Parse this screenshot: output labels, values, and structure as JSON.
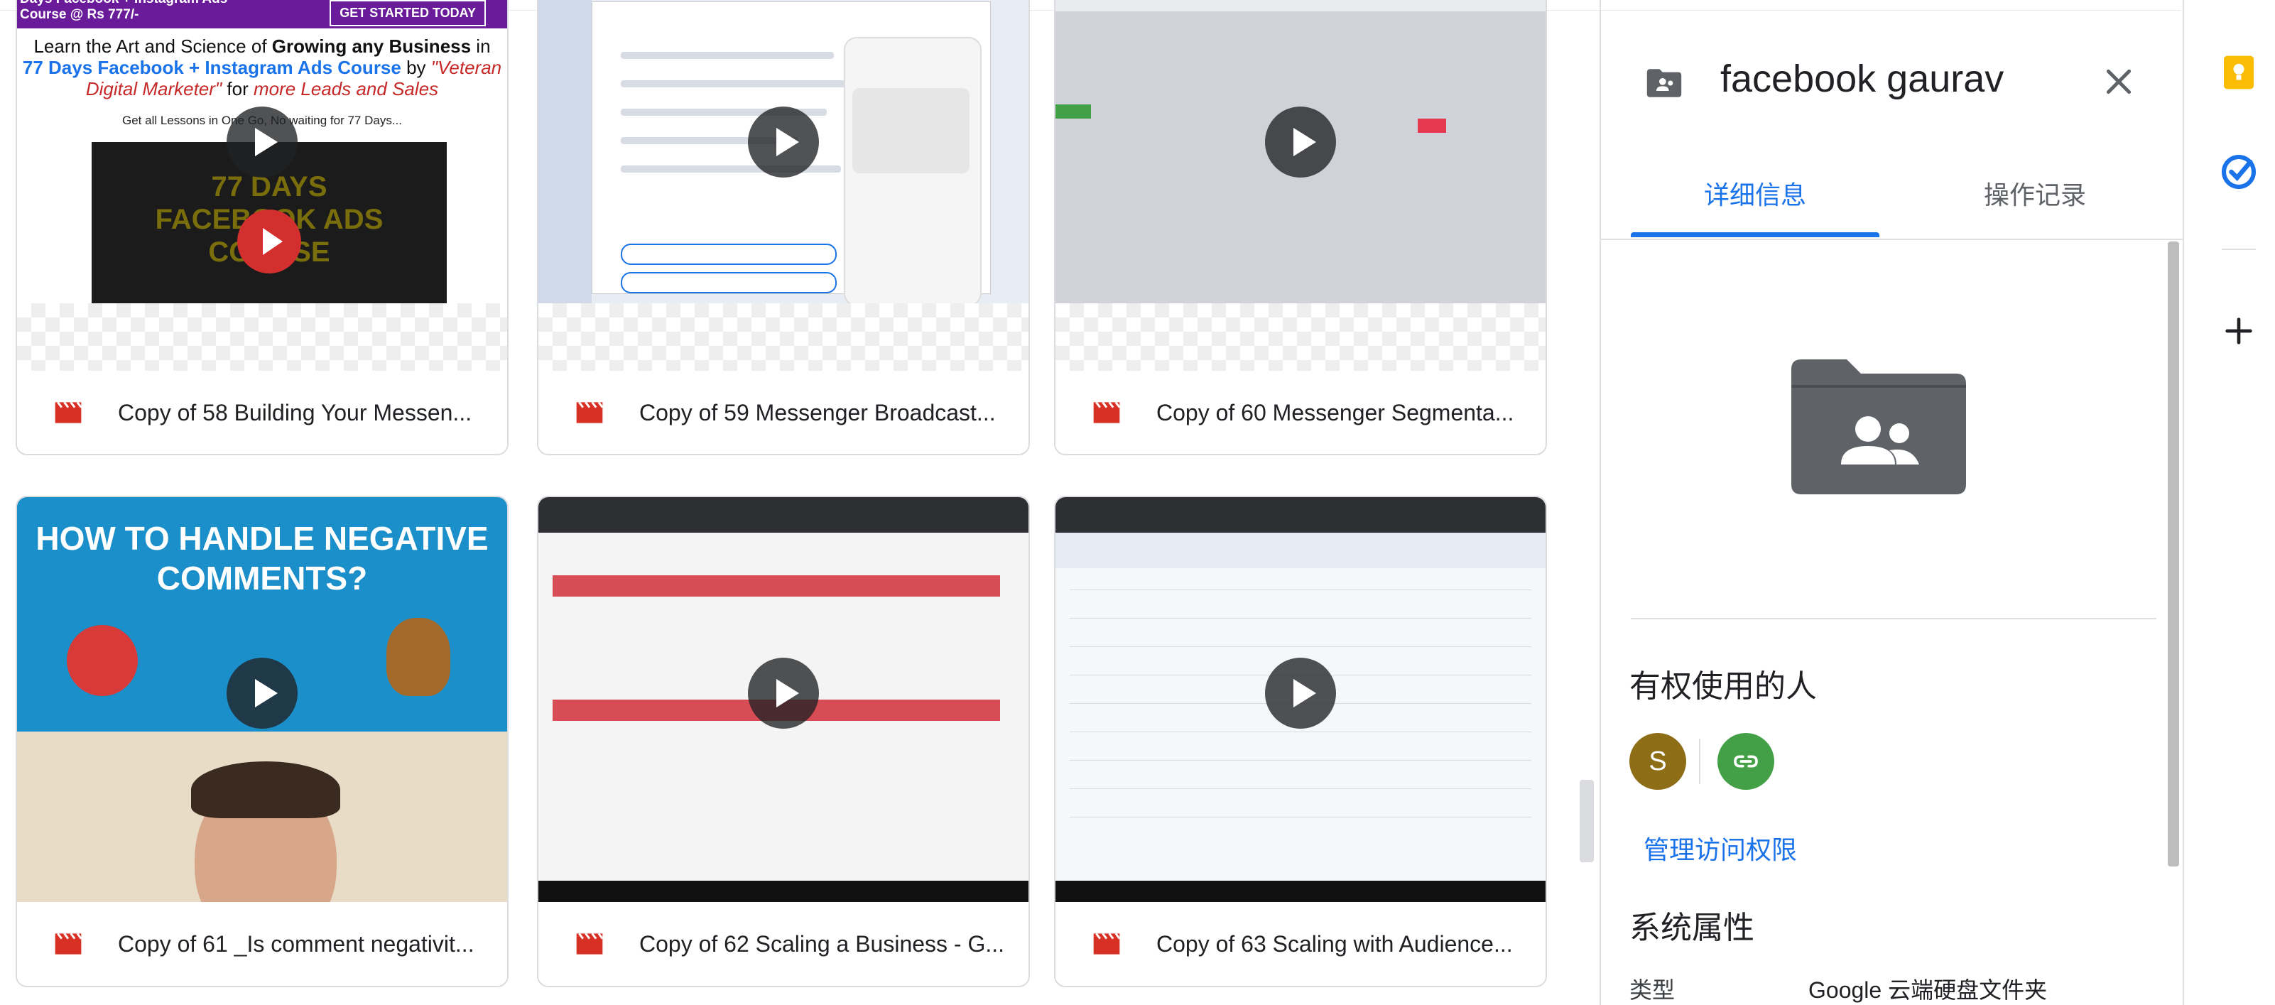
{
  "files": [
    {
      "title": "Copy of 58 Building Your Messen..."
    },
    {
      "title": "Copy of 59 Messenger Broadcast..."
    },
    {
      "title": "Copy of 60 Messenger Segmenta..."
    },
    {
      "title": "Copy of 61 _Is comment negativit..."
    },
    {
      "title": "Copy of 62 Scaling a Business - G..."
    },
    {
      "title": "Copy of 63 Scaling with Audience..."
    }
  ],
  "thumbs": {
    "ad_band": "Days Facebook + Instagram Ads Course @ Rs 777/-",
    "ad_cta": "GET STARTED TODAY",
    "ad_headline_1": "Learn the Art and Science of ",
    "ad_headline_1b": "Growing any Business",
    "ad_headline_1c": " in",
    "ad_headline_2": "77 Days Facebook + Instagram Ads Course",
    "ad_headline_2b": " by ",
    "ad_headline_2c": "\"Veteran",
    "ad_headline_3": "Digital Marketer\"",
    "ad_headline_3b": " for ",
    "ad_headline_3c": "more Leads and Sales",
    "ad_sub": "Get all Lessons in One Go, No waiting for 77 Days...",
    "ad_video": "77 DAYS FACEBOOK ADS COURSE",
    "neg_text": "HOW TO HANDLE NEGATIVE COMMENTS?"
  },
  "panel": {
    "title": "facebook gaurav",
    "tabs": [
      "详细信息",
      "操作记录"
    ],
    "access_title": "有权使用的人",
    "avatar_letter": "S",
    "manage_access": "管理访问权限",
    "system_props_title": "系统属性",
    "prop_type_label": "类型",
    "prop_type_value": "Google 云端硬盘文件夹"
  },
  "colors": {
    "accent": "#1a73e8",
    "video_icon": "#d93025",
    "avatar_s": "#8d6e17",
    "avatar_link": "#43a047",
    "keep": "#fbbc04",
    "tasks": "#1a73e8"
  },
  "icons": {
    "video": "video-file-icon",
    "folder_shared": "shared-folder-icon",
    "close": "close-icon",
    "link": "link-icon",
    "keep": "keep-icon",
    "tasks": "tasks-icon",
    "add": "add-icon"
  }
}
